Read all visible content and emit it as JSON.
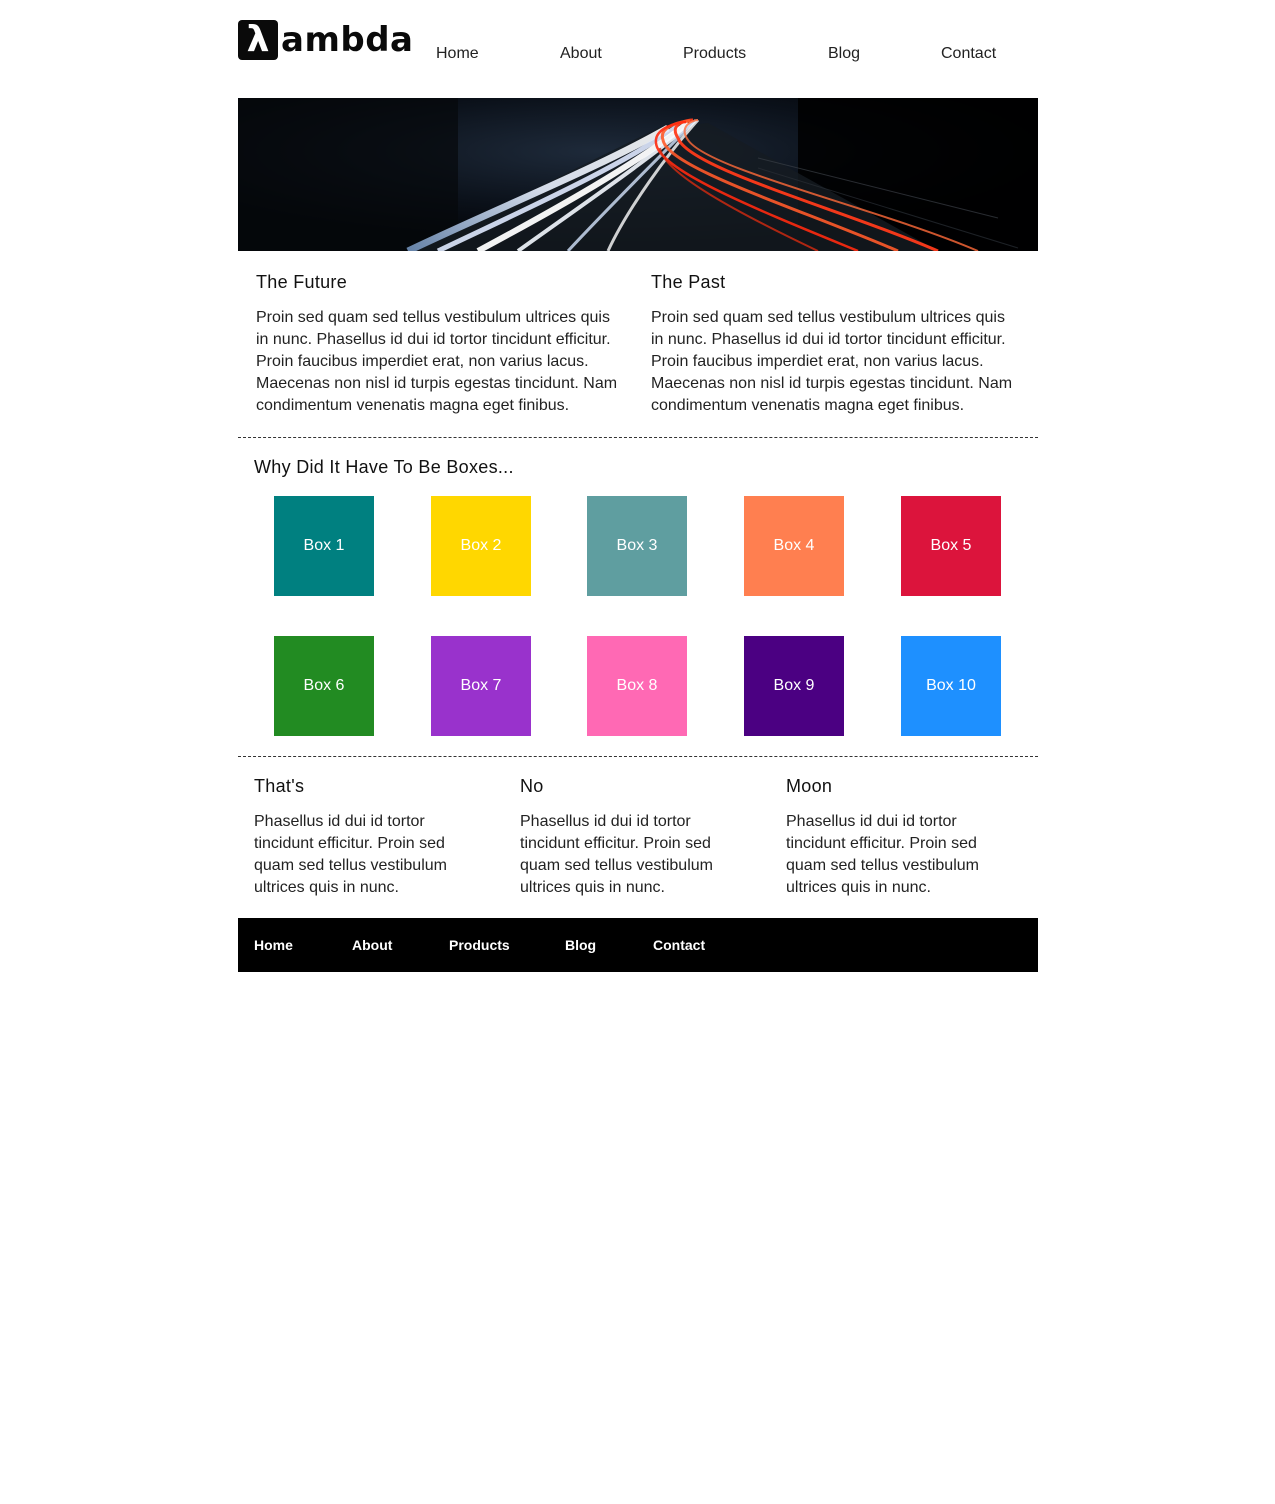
{
  "brand": {
    "logo_mark": "λ",
    "logo_text": "ambda",
    "icon": "lambda-logo-icon"
  },
  "nav": {
    "items": [
      "Home",
      "About",
      "Products",
      "Blog",
      "Contact"
    ]
  },
  "hero": {
    "image": "night-highway-light-trails"
  },
  "columns": [
    {
      "title": "The Future",
      "body": "Proin sed quam sed tellus vestibulum ultrices quis in nunc. Phasellus id dui id tortor tincidunt efficitur. Proin faucibus imperdiet erat, non varius lacus. Maecenas non nisl id turpis egestas tincidunt. Nam condimentum venenatis magna eget finibus."
    },
    {
      "title": "The Past",
      "body": "Proin sed quam sed tellus vestibulum ultrices quis in nunc. Phasellus id dui id tortor tincidunt efficitur. Proin faucibus imperdiet erat, non varius lacus. Maecenas non nisl id turpis egestas tincidunt. Nam condimentum venenatis magna eget finibus."
    }
  ],
  "boxes": {
    "title": "Why Did It Have To Be Boxes...",
    "items": [
      {
        "label": "Box 1",
        "color": "#008080"
      },
      {
        "label": "Box 2",
        "color": "#FFD700"
      },
      {
        "label": "Box 3",
        "color": "#5F9EA0"
      },
      {
        "label": "Box 4",
        "color": "#FF7F50"
      },
      {
        "label": "Box 5",
        "color": "#DC143C"
      },
      {
        "label": "Box 6",
        "color": "#228B22"
      },
      {
        "label": "Box 7",
        "color": "#9932CC"
      },
      {
        "label": "Box 8",
        "color": "#FF69B4"
      },
      {
        "label": "Box 9",
        "color": "#4B0082"
      },
      {
        "label": "Box 10",
        "color": "#1E90FF"
      }
    ]
  },
  "trio": [
    {
      "title": "That's",
      "body": "Phasellus id dui id tortor tincidunt efficitur. Proin sed quam sed tellus vestibulum ultrices quis in nunc."
    },
    {
      "title": "No",
      "body": "Phasellus id dui id tortor tincidunt efficitur. Proin sed quam sed tellus vestibulum ultrices quis in nunc."
    },
    {
      "title": "Moon",
      "body": "Phasellus id dui id tortor tincidunt efficitur. Proin sed quam sed tellus vestibulum ultrices quis in nunc."
    }
  ],
  "footer": {
    "items": [
      "Home",
      "About",
      "Products",
      "Blog",
      "Contact"
    ]
  }
}
